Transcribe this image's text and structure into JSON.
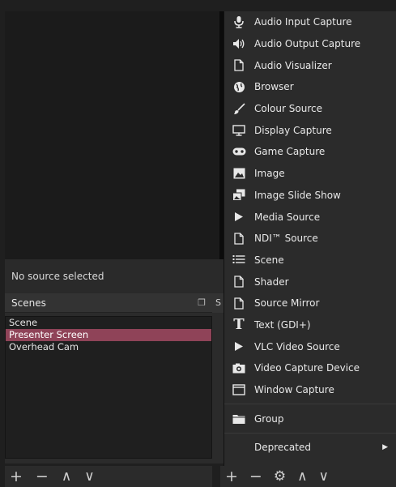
{
  "preview": {
    "status": "No source selected"
  },
  "scenes": {
    "title": "Scenes",
    "items": [
      "Scene",
      "Presenter Screen",
      "Overhead Cam"
    ],
    "selected_index": 1
  },
  "sources": {
    "title_fragment": "S"
  },
  "context_menu": {
    "items": [
      {
        "label": "Audio Input Capture",
        "icon": "microphone-icon"
      },
      {
        "label": "Audio Output Capture",
        "icon": "speaker-icon"
      },
      {
        "label": "Audio Visualizer",
        "icon": "file-icon"
      },
      {
        "label": "Browser",
        "icon": "globe-icon"
      },
      {
        "label": "Colour Source",
        "icon": "brush-icon"
      },
      {
        "label": "Display Capture",
        "icon": "monitor-icon"
      },
      {
        "label": "Game Capture",
        "icon": "gamepad-icon"
      },
      {
        "label": "Image",
        "icon": "image-icon"
      },
      {
        "label": "Image Slide Show",
        "icon": "slideshow-icon"
      },
      {
        "label": "Media Source",
        "icon": "play-icon"
      },
      {
        "label": "NDI™ Source",
        "icon": "file-icon"
      },
      {
        "label": "Scene",
        "icon": "list-icon"
      },
      {
        "label": "Shader",
        "icon": "file-icon"
      },
      {
        "label": "Source Mirror",
        "icon": "file-icon"
      },
      {
        "label": "Text (GDI+)",
        "icon": "text-icon"
      },
      {
        "label": "VLC Video Source",
        "icon": "play-icon"
      },
      {
        "label": "Video Capture Device",
        "icon": "camera-icon"
      },
      {
        "label": "Window Capture",
        "icon": "window-icon"
      }
    ],
    "group_label": "Group",
    "deprecated_label": "Deprecated"
  },
  "colors": {
    "selection": "#8f4358",
    "panel": "#2b2b2b",
    "background": "#1f1f1f"
  }
}
